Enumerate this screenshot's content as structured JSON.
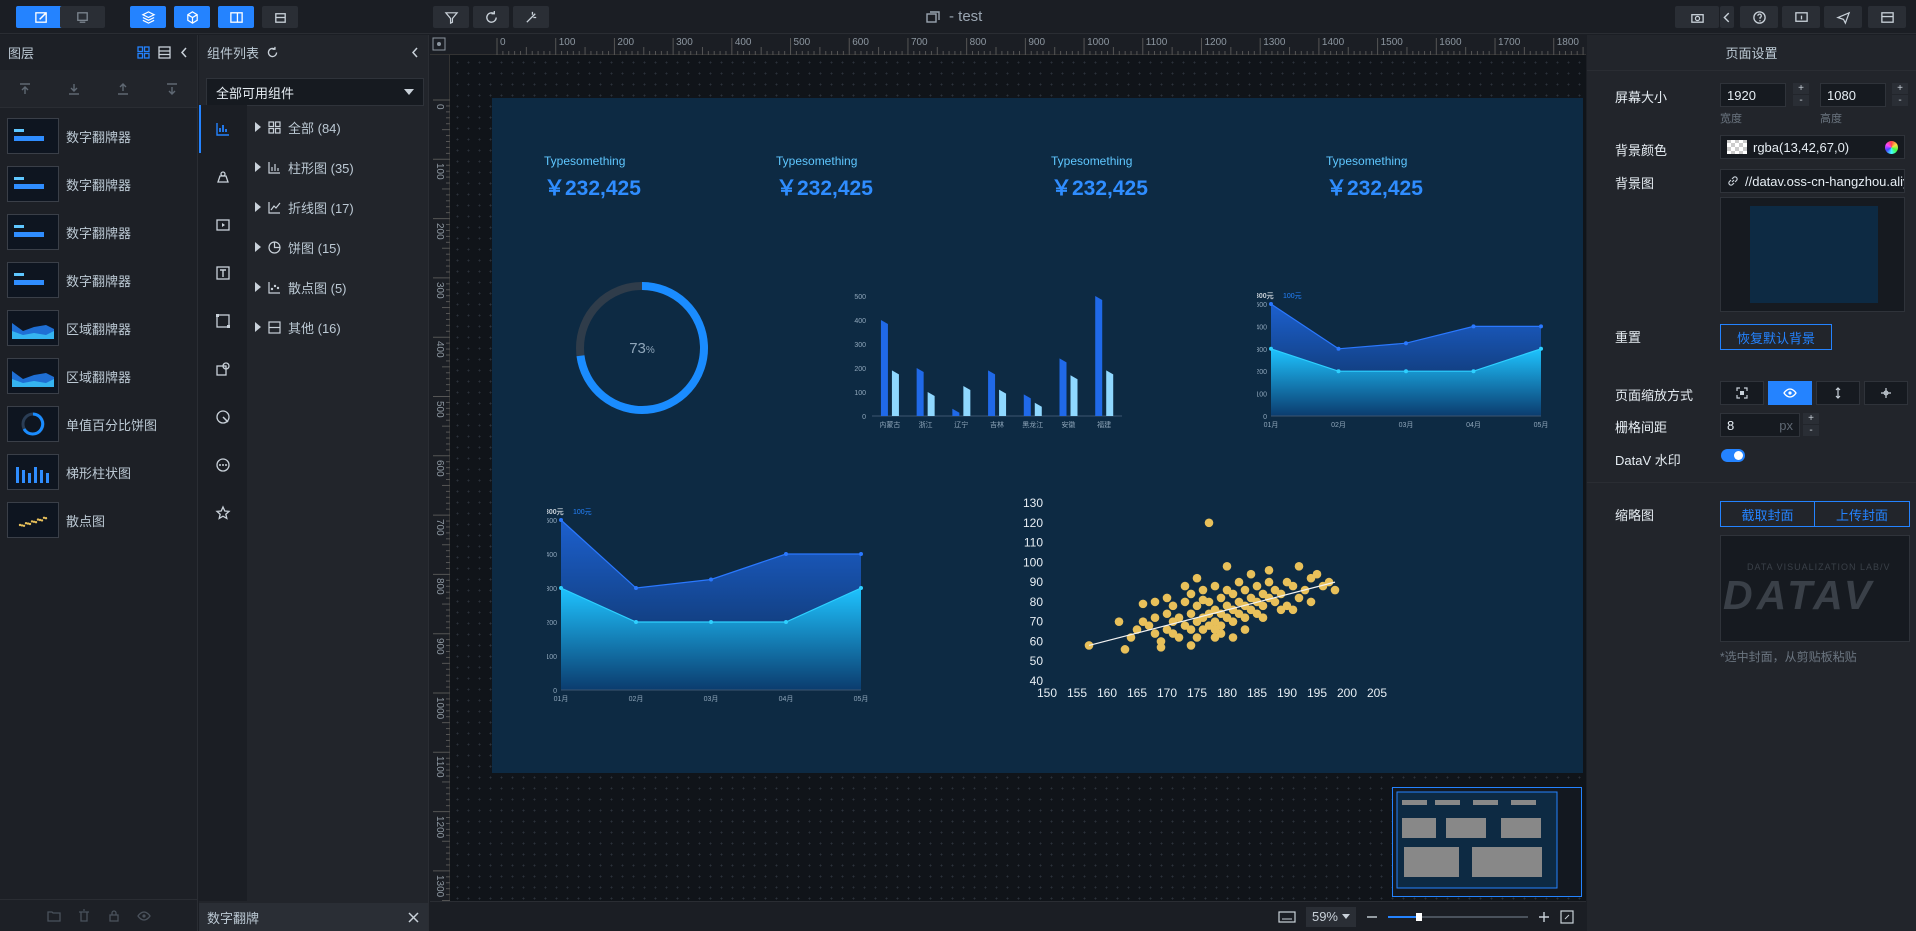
{
  "window": {
    "title": "- test"
  },
  "layers_panel": {
    "title": "图层",
    "items": [
      {
        "label": "数字翻牌器",
        "type": "flip"
      },
      {
        "label": "数字翻牌器",
        "type": "flip"
      },
      {
        "label": "数字翻牌器",
        "type": "flip"
      },
      {
        "label": "数字翻牌器",
        "type": "flip"
      },
      {
        "label": "区域翻牌器",
        "type": "area"
      },
      {
        "label": "区域翻牌器",
        "type": "area"
      },
      {
        "label": "单值百分比饼图",
        "type": "pie"
      },
      {
        "label": "梯形柱状图",
        "type": "bar"
      },
      {
        "label": "散点图",
        "type": "scatter"
      }
    ]
  },
  "component_panel": {
    "title": "组件列表",
    "filter": "全部可用组件",
    "categories": [
      {
        "label": "全部 (84)"
      },
      {
        "label": "柱形图 (35)"
      },
      {
        "label": "折线图 (17)"
      },
      {
        "label": "饼图 (15)"
      },
      {
        "label": "散点图 (5)"
      },
      {
        "label": "其他 (16)"
      }
    ],
    "footer": "数字翻牌"
  },
  "rulers": {
    "h": [
      "0",
      "100",
      "200",
      "300",
      "400",
      "500",
      "600",
      "700",
      "800",
      "900",
      "1000",
      "1100",
      "1200",
      "1300",
      "1400",
      "1500",
      "1600",
      "1700",
      "1800"
    ],
    "v": [
      "0",
      "100",
      "200",
      "300",
      "400",
      "500",
      "600",
      "700",
      "800",
      "900",
      "1000",
      "1100",
      "1200",
      "1300"
    ]
  },
  "canvas": {
    "flips": [
      {
        "title": "Typesomething",
        "value": "￥232,425"
      },
      {
        "title": "Typesomething",
        "value": "￥232,425"
      },
      {
        "title": "Typesomething",
        "value": "￥232,425"
      },
      {
        "title": "Typesomething",
        "value": "￥232,425"
      }
    ],
    "zoom": "59%"
  },
  "chart_data": [
    {
      "type": "pie",
      "value": 73,
      "label": "73",
      "unit": "%"
    },
    {
      "type": "bar",
      "categories": [
        "内蒙古",
        "浙江",
        "辽宁",
        "吉林",
        "黑龙江",
        "安徽",
        "福建"
      ],
      "series": [
        {
          "values": [
            400,
            200,
            30,
            190,
            90,
            240,
            500
          ]
        },
        {
          "values": [
            190,
            100,
            125,
            110,
            55,
            170,
            190
          ]
        }
      ],
      "ylim": [
        0,
        500
      ],
      "yticks": [
        "0",
        "100",
        "200",
        "300",
        "400",
        "500"
      ]
    },
    {
      "type": "area",
      "categories": [
        "01月",
        "02月",
        "03月",
        "04月",
        "05月"
      ],
      "legend": [
        "300元",
        "100元"
      ],
      "series": [
        {
          "name": "300元",
          "values": [
            500,
            300,
            325,
            400,
            400
          ]
        },
        {
          "name": "100元",
          "values": [
            300,
            200,
            200,
            200,
            300
          ]
        }
      ],
      "ylim": [
        0,
        500
      ],
      "yticks": [
        "0",
        "100",
        "200",
        "300",
        "400",
        "500"
      ]
    },
    {
      "type": "area",
      "categories": [
        "01月",
        "02月",
        "03月",
        "04月",
        "05月"
      ],
      "legend": [
        "300元",
        "100元"
      ],
      "series": [
        {
          "name": "300元",
          "values": [
            500,
            300,
            325,
            400,
            400
          ]
        },
        {
          "name": "100元",
          "values": [
            300,
            200,
            200,
            200,
            300
          ]
        }
      ],
      "ylim": [
        0,
        500
      ],
      "yticks": [
        "0",
        "100",
        "200",
        "300",
        "400",
        "500"
      ]
    },
    {
      "type": "scatter",
      "xlim": [
        150,
        205
      ],
      "ylim": [
        40,
        130
      ],
      "xticks": [
        "150",
        "155",
        "160",
        "165",
        "170",
        "175",
        "180",
        "185",
        "190",
        "195",
        "200",
        "205"
      ],
      "yticks": [
        "40",
        "50",
        "60",
        "70",
        "80",
        "90",
        "100",
        "110",
        "120",
        "130"
      ],
      "trend": [
        [
          157,
          58
        ],
        [
          198,
          90
        ]
      ],
      "points": [
        [
          157,
          58
        ],
        [
          163,
          56
        ],
        [
          164,
          62
        ],
        [
          165,
          66
        ],
        [
          166,
          70
        ],
        [
          167,
          68
        ],
        [
          168,
          72
        ],
        [
          168,
          64
        ],
        [
          169,
          60
        ],
        [
          170,
          74
        ],
        [
          170,
          66
        ],
        [
          171,
          70
        ],
        [
          171,
          78
        ],
        [
          172,
          62
        ],
        [
          172,
          72
        ],
        [
          173,
          68
        ],
        [
          173,
          80
        ],
        [
          174,
          66
        ],
        [
          174,
          74
        ],
        [
          174,
          84
        ],
        [
          175,
          70
        ],
        [
          175,
          62
        ],
        [
          175,
          78
        ],
        [
          176,
          72
        ],
        [
          176,
          86
        ],
        [
          176,
          66
        ],
        [
          177,
          74
        ],
        [
          177,
          80
        ],
        [
          177,
          68
        ],
        [
          178,
          76
        ],
        [
          178,
          70
        ],
        [
          178,
          88
        ],
        [
          178,
          62
        ],
        [
          179,
          74
        ],
        [
          179,
          82
        ],
        [
          179,
          68
        ],
        [
          180,
          78
        ],
        [
          180,
          72
        ],
        [
          180,
          86
        ],
        [
          181,
          76
        ],
        [
          181,
          70
        ],
        [
          181,
          84
        ],
        [
          182,
          80
        ],
        [
          182,
          74
        ],
        [
          182,
          90
        ],
        [
          183,
          78
        ],
        [
          183,
          72
        ],
        [
          183,
          86
        ],
        [
          184,
          82
        ],
        [
          184,
          76
        ],
        [
          185,
          80
        ],
        [
          185,
          88
        ],
        [
          185,
          74
        ],
        [
          186,
          84
        ],
        [
          186,
          78
        ],
        [
          187,
          82
        ],
        [
          187,
          96
        ],
        [
          188,
          86
        ],
        [
          188,
          80
        ],
        [
          189,
          84
        ],
        [
          190,
          90
        ],
        [
          190,
          78
        ],
        [
          191,
          88
        ],
        [
          192,
          98
        ],
        [
          193,
          86
        ],
        [
          194,
          92
        ],
        [
          195,
          94
        ],
        [
          196,
          88
        ],
        [
          197,
          90
        ],
        [
          198,
          86
        ],
        [
          177,
          120
        ],
        [
          166,
          79
        ],
        [
          169,
          57
        ],
        [
          173,
          88
        ],
        [
          179,
          64
        ],
        [
          184,
          94
        ],
        [
          186,
          72
        ],
        [
          189,
          76
        ],
        [
          192,
          82
        ],
        [
          162,
          70
        ],
        [
          170,
          82
        ],
        [
          175,
          92
        ],
        [
          180,
          98
        ],
        [
          183,
          66
        ],
        [
          187,
          90
        ],
        [
          191,
          76
        ],
        [
          194,
          80
        ],
        [
          174,
          58
        ],
        [
          181,
          62
        ],
        [
          176,
          81
        ],
        [
          178,
          66
        ],
        [
          171,
          64
        ],
        [
          168,
          80
        ]
      ]
    }
  ],
  "settings": {
    "title": "页面设置",
    "screen_size_label": "屏幕大小",
    "width": "1920",
    "height": "1080",
    "width_label": "宽度",
    "height_label": "高度",
    "bg_color_label": "背景颜色",
    "bg_color": "rgba(13,42,67,0)",
    "bg_image_label": "背景图",
    "bg_image_url": "//datav.oss-cn-hangzhou.aliyu",
    "reset_label": "重置",
    "reset_button": "恢复默认背景",
    "scale_label": "页面缩放方式",
    "grid_label": "栅格间距",
    "grid_value": "8",
    "grid_unit": "px",
    "watermark_label": "DataV 水印",
    "thumb_label": "缩略图",
    "capture_button": "截取封面",
    "upload_button": "上传封面",
    "thumb_hint": "*选中封面，从剪贴板粘贴",
    "watermark_top": "DATA VISUALIZATION LAB/V",
    "watermark_logo": "DATAV"
  },
  "colors": {
    "accent": "#2483ff",
    "page_bg": "#0d2a43",
    "flip_value": "#2f8dff",
    "scatter": "#e8c05a"
  }
}
